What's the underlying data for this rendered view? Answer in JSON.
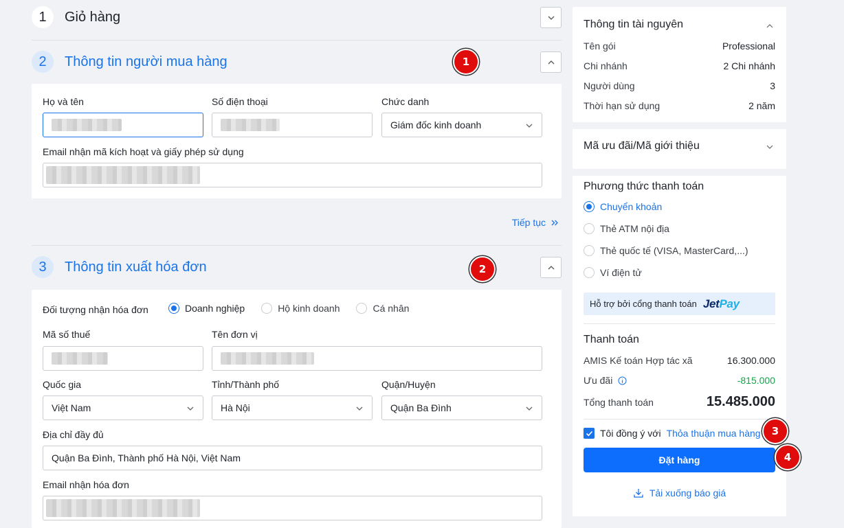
{
  "steps": {
    "cart": {
      "number": "1",
      "title": "Giỏ hàng"
    },
    "buyer": {
      "number": "2",
      "title": "Thông tin người mua hàng"
    },
    "invoice": {
      "number": "3",
      "title": "Thông tin xuất hóa đơn"
    }
  },
  "buyer_form": {
    "name_label": "Họ và tên",
    "phone_label": "Số điện thoại",
    "position_label": "Chức danh",
    "position_value": "Giám đốc kinh doanh",
    "email_label": "Email nhận mã kích hoạt và giấy phép sử dụng",
    "continue_label": "Tiếp tục"
  },
  "invoice_form": {
    "recipient_label": "Đối tượng nhận hóa đơn",
    "recipient_options": [
      "Doanh nghiệp",
      "Hộ kinh doanh",
      "Cá nhân"
    ],
    "selected_recipient": "Doanh nghiệp",
    "tax_label": "Mã số thuế",
    "unit_label": "Tên đơn vị",
    "country_label": "Quốc gia",
    "country_value": "Việt Nam",
    "city_label": "Tỉnh/Thành phố",
    "city_value": "Hà Nội",
    "district_label": "Quận/Huyện",
    "district_value": "Quận Ba Đình",
    "address_label": "Địa chỉ đầy đủ",
    "address_value": "Quận Ba Đình, Thành phố Hà Nội, Việt Nam",
    "invoice_email_label": "Email nhận hóa đơn"
  },
  "markers": [
    "1",
    "2",
    "3",
    "4"
  ],
  "resource_info": {
    "title": "Thông tin tài nguyên",
    "rows": [
      {
        "key": "Tên gói",
        "value": "Professional"
      },
      {
        "key": "Chi nhánh",
        "value": "2 Chi nhánh"
      },
      {
        "key": "Người dùng",
        "value": "3"
      },
      {
        "key": "Thời hạn sử dụng",
        "value": "2 năm"
      }
    ]
  },
  "promo": {
    "title": "Mã ưu đãi/Mã giới thiệu"
  },
  "payment": {
    "title": "Phương thức thanh toán",
    "methods": [
      "Chuyển khoản",
      "Thẻ ATM nội địa",
      "Thẻ quốc tế (VISA, MasterCard,...)",
      "Ví điện tử"
    ],
    "selected": "Chuyển khoản",
    "support_text": "Hỗ trợ bởi cổng thanh toán",
    "logo_part1": "Jet",
    "logo_part2": "Pay"
  },
  "summary": {
    "title": "Thanh toán",
    "product_label": "AMIS Kế toán Hợp tác xã",
    "product_price": "16.300.000",
    "discount_label": "Ưu đãi",
    "discount_value": "-815.000",
    "total_label": "Tổng thanh toán",
    "total_value": "15.485.000",
    "agree_prefix": "Tôi đồng ý với",
    "agree_link": "Thỏa thuận mua hàng",
    "order_button": "Đặt hàng",
    "download_label": "Tải xuống báo giá"
  },
  "colors": {
    "primary": "#1a73e8",
    "button": "#0d6efd",
    "discount": "#16a34a",
    "marker": "#e00b0b"
  }
}
